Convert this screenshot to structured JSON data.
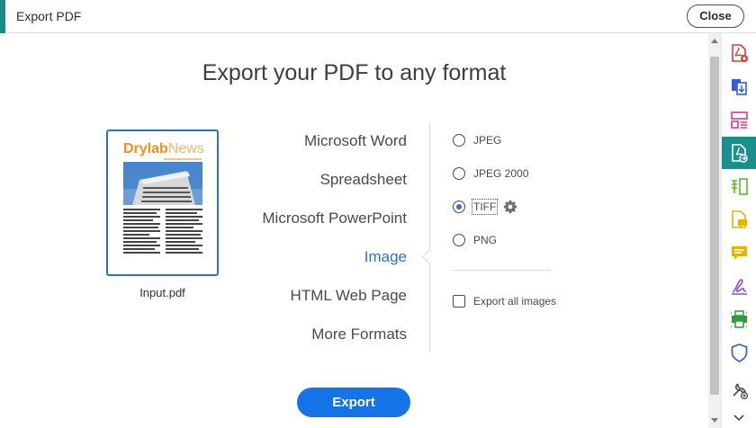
{
  "header": {
    "title": "Export PDF",
    "close_label": "Close"
  },
  "main": {
    "title": "Export your PDF to any format",
    "file_name": "Input.pdf",
    "thumbnail": {
      "logo_part1": "Drylab",
      "logo_part2": "News"
    },
    "formats": [
      {
        "label": "Microsoft Word",
        "active": false
      },
      {
        "label": "Spreadsheet",
        "active": false
      },
      {
        "label": "Microsoft PowerPoint",
        "active": false
      },
      {
        "label": "Image",
        "active": true
      },
      {
        "label": "HTML Web Page",
        "active": false
      },
      {
        "label": "More Formats",
        "active": false
      }
    ],
    "image_options": [
      {
        "label": "JPEG",
        "checked": false
      },
      {
        "label": "JPEG 2000",
        "checked": false
      },
      {
        "label": "TIFF",
        "checked": true
      },
      {
        "label": "PNG",
        "checked": false
      }
    ],
    "export_all_images": {
      "label": "Export all images",
      "checked": false
    },
    "export_label": "Export"
  },
  "tools": [
    {
      "icon": "create-pdf-icon",
      "color": "#e03a3a"
    },
    {
      "icon": "combine-files-icon",
      "color": "#3a5bd9"
    },
    {
      "icon": "organize-pages-icon",
      "color": "#d93a8c"
    },
    {
      "icon": "export-pdf-icon",
      "color": "#ffffff",
      "active": true
    },
    {
      "icon": "edit-pdf-icon",
      "color": "#5ab82a"
    },
    {
      "icon": "comment-icon",
      "color": "#e6b400"
    },
    {
      "icon": "fill-sign-icon",
      "color": "#e6b400"
    },
    {
      "icon": "request-signatures-icon",
      "color": "#8a4ad9"
    },
    {
      "icon": "print-production-icon",
      "color": "#2e9c3c"
    },
    {
      "icon": "protect-icon",
      "color": "#3a5bd9"
    },
    {
      "icon": "more-tools-icon",
      "color": "#4a4a4a"
    }
  ],
  "colors": {
    "accent": "#1473e6",
    "active_format": "#2c72c7",
    "teal": "#1b8f8c"
  }
}
